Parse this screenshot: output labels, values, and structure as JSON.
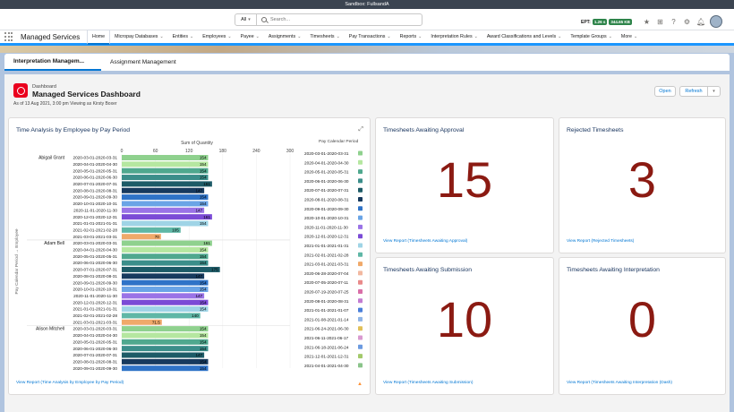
{
  "window_title": "Sandbox: FullsandA",
  "search": {
    "scope": "All",
    "placeholder": "Search..."
  },
  "header": {
    "ept_label": "EPT:",
    "ept_a": "1.26 s",
    "ept_b": "344.65 KB"
  },
  "app_name": "Managed Services",
  "nav": [
    {
      "label": "Home",
      "active": true,
      "chevron": false
    },
    {
      "label": "Micropay Databases",
      "active": false,
      "chevron": true
    },
    {
      "label": "Entities",
      "active": false,
      "chevron": true
    },
    {
      "label": "Employees",
      "active": false,
      "chevron": true
    },
    {
      "label": "Payee",
      "active": false,
      "chevron": true
    },
    {
      "label": "Assignments",
      "active": false,
      "chevron": true
    },
    {
      "label": "Timesheets",
      "active": false,
      "chevron": true
    },
    {
      "label": "Pay Transactions",
      "active": false,
      "chevron": true
    },
    {
      "label": "Reports",
      "active": false,
      "chevron": true
    },
    {
      "label": "Interpretation Rules",
      "active": false,
      "chevron": true
    },
    {
      "label": "Award Classifications and Levels",
      "active": false,
      "chevron": true
    },
    {
      "label": "Template Groups",
      "active": false,
      "chevron": true
    },
    {
      "label": "More",
      "active": false,
      "chevron": true
    }
  ],
  "content_tabs": [
    "Interpretation Managem...",
    "Assignment Management"
  ],
  "dashboard": {
    "label": "Dashboard",
    "title": "Managed Services Dashboard",
    "as_of": "As of 13 Aug 2021, 3:00 pm Viewing as Kirsty Boxer",
    "open_label": "Open",
    "refresh_label": "Refresh"
  },
  "cards": {
    "awaiting_approval": {
      "title": "Timesheets Awaiting Approval",
      "value": "15",
      "link": "View Report (Timesheets Awaiting Approval)"
    },
    "rejected": {
      "title": "Rejected Timesheets",
      "value": "3",
      "link": "View Report (Rejected Timesheets)"
    },
    "awaiting_submission": {
      "title": "Timesheets Awaiting Submission",
      "value": "10",
      "link": "View Report (Timesheets Awaiting Submission)"
    },
    "awaiting_interpretation": {
      "title": "Timesheets Awaiting Interpretation",
      "value": "0",
      "link": "View Report (Timesheets Awaiting Interpretation (Dash)"
    }
  },
  "chart_card": {
    "title": "Time Analysis by Employee by Pay Period",
    "link": "View Report (Time Analysis by Employee by Pay Period)"
  },
  "chart_data": {
    "type": "bar",
    "orientation": "horizontal",
    "title": "Sum of Quantity",
    "ylabel": "Pay Calendar Period → Employee",
    "legend_title": "Pay Calendar Period",
    "xticks": [
      0,
      60,
      120,
      180,
      240,
      300
    ],
    "xlim": [
      0,
      300
    ],
    "groups": [
      {
        "employee": "Abigail Grant",
        "bars": [
          {
            "period": "2020-03-01-2020-03-31",
            "value": 154,
            "color": "#8fd18e"
          },
          {
            "period": "2020-04-01-2020-04-30",
            "value": 154,
            "color": "#b5e7a0"
          },
          {
            "period": "2020-05-01-2020-05-31",
            "value": 154,
            "color": "#4fa88e"
          },
          {
            "period": "2020-06-01-2020-06-30",
            "value": 154,
            "color": "#3b8e8a"
          },
          {
            "period": "2020-07-01-2020-07-31",
            "value": 161,
            "color": "#1d5b67"
          },
          {
            "period": "2020-08-01-2020-08-31",
            "value": 147,
            "color": "#173a5e"
          },
          {
            "period": "2020-09-01-2020-09-30",
            "value": 154,
            "color": "#2f73c7"
          },
          {
            "period": "2020-10-01-2020-10-31",
            "value": 154,
            "color": "#6aa4e6"
          },
          {
            "period": "2020-11-01-2020-11-30",
            "value": 147,
            "color": "#9a73e6"
          },
          {
            "period": "2020-12-01-2020-12-31",
            "value": 161,
            "color": "#7b4bd6"
          },
          {
            "period": "2021-01-01-2021-01-31",
            "value": 154,
            "color": "#9fd4e6"
          },
          {
            "period": "2021-02-01-2021-02-28",
            "value": 105,
            "color": "#5fb7a6"
          },
          {
            "period": "2021-03-01-2021-03-31",
            "value": 70,
            "color": "#f0a96a"
          }
        ]
      },
      {
        "employee": "Adam Bell",
        "bars": [
          {
            "period": "2020-03-01-2020-03-31",
            "value": 161,
            "color": "#8fd18e"
          },
          {
            "period": "2020-04-01-2020-04-30",
            "value": 154,
            "color": "#b5e7a0"
          },
          {
            "period": "2020-05-01-2020-05-31",
            "value": 154,
            "color": "#4fa88e"
          },
          {
            "period": "2020-06-01-2020-06-30",
            "value": 154,
            "color": "#3b8e8a"
          },
          {
            "period": "2020-07-01-2020-07-31",
            "value": 175,
            "color": "#1d5b67"
          },
          {
            "period": "2020-08-01-2020-08-31",
            "value": 147,
            "color": "#173a5e"
          },
          {
            "period": "2020-09-01-2020-09-30",
            "value": 154,
            "color": "#2f73c7"
          },
          {
            "period": "2020-10-01-2020-10-31",
            "value": 154,
            "color": "#6aa4e6"
          },
          {
            "period": "2020-11-01-2020-11-30",
            "value": 147,
            "color": "#9a73e6"
          },
          {
            "period": "2020-12-01-2020-12-31",
            "value": 154,
            "color": "#7b4bd6"
          },
          {
            "period": "2021-01-01-2021-01-31",
            "value": 154,
            "color": "#9fd4e6"
          },
          {
            "period": "2021-02-01-2021-02-28",
            "value": 140,
            "color": "#5fb7a6"
          },
          {
            "period": "2021-03-01-2021-03-31",
            "value": 71.5,
            "color": "#f0a96a"
          }
        ]
      },
      {
        "employee": "Alison Mitchell",
        "bars": [
          {
            "period": "2020-03-01-2020-03-31",
            "value": 154,
            "color": "#8fd18e"
          },
          {
            "period": "2020-04-01-2020-04-30",
            "value": 154,
            "color": "#b5e7a0"
          },
          {
            "period": "2020-05-01-2020-05-31",
            "value": 154,
            "color": "#4fa88e"
          },
          {
            "period": "2020-06-01-2020-06-30",
            "value": 154,
            "color": "#3b8e8a"
          },
          {
            "period": "2020-07-01-2020-07-31",
            "value": 147,
            "color": "#1d5b67"
          },
          {
            "period": "2020-08-01-2020-08-31",
            "value": 154,
            "color": "#173a5e"
          },
          {
            "period": "2020-09-01-2020-09-30",
            "value": 154,
            "color": "#2f73c7"
          }
        ]
      }
    ],
    "legend": [
      {
        "label": "2020-03-01-2020-03-31",
        "color": "#8fd18e"
      },
      {
        "label": "2020-04-01-2020-04-30",
        "color": "#b5e7a0"
      },
      {
        "label": "2020-05-01-2020-05-31",
        "color": "#4fa88e"
      },
      {
        "label": "2020-06-01-2020-06-30",
        "color": "#3b8e8a"
      },
      {
        "label": "2020-07-01-2020-07-31",
        "color": "#1d5b67"
      },
      {
        "label": "2020-08-01-2020-08-31",
        "color": "#173a5e"
      },
      {
        "label": "2020-09-01-2020-09-30",
        "color": "#2f73c7"
      },
      {
        "label": "2020-10-01-2020-10-31",
        "color": "#6aa4e6"
      },
      {
        "label": "2020-11-01-2020-11-30",
        "color": "#9a73e6"
      },
      {
        "label": "2020-12-01-2020-12-31",
        "color": "#7b4bd6"
      },
      {
        "label": "2021-01-01-2021-01-31",
        "color": "#9fd4e6"
      },
      {
        "label": "2021-02-01-2021-02-28",
        "color": "#5fb7a6"
      },
      {
        "label": "2021-03-01-2021-03-31",
        "color": "#f0a96a"
      },
      {
        "label": "2020-06-28-2020-07-04",
        "color": "#f2b8a0"
      },
      {
        "label": "2020-07-05-2020-07-11",
        "color": "#e98a8a"
      },
      {
        "label": "2020-07-19-2020-07-25",
        "color": "#d96fa8"
      },
      {
        "label": "2020-08-01-2020-08-31",
        "color": "#c37cd1"
      },
      {
        "label": "2021-01-01-2021-01-07",
        "color": "#4a7fd9"
      },
      {
        "label": "2021-01-08-2021-01-14",
        "color": "#8fb4e6"
      },
      {
        "label": "2021-06-24-2021-06-30",
        "color": "#e0c05a"
      },
      {
        "label": "2021-06-11-2021-06-17",
        "color": "#d99ad0"
      },
      {
        "label": "2021-06-18-2021-06-24",
        "color": "#6c9ae0"
      },
      {
        "label": "2021-12-01-2021-12-31",
        "color": "#a3c96b"
      },
      {
        "label": "2021-04-01-2021-04-30",
        "color": "#8ac48a"
      }
    ]
  }
}
